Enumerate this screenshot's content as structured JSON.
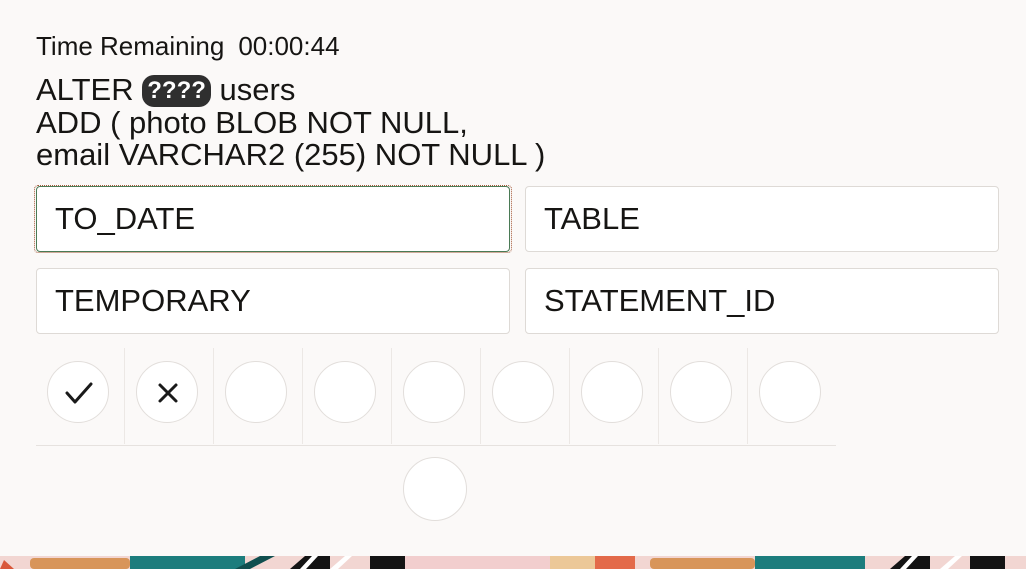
{
  "timer": {
    "label": "Time Remaining",
    "value": "00:00:44"
  },
  "question": {
    "line1_pre": "ALTER",
    "blank": "????",
    "line1_post": "users",
    "line2": "ADD ( photo BLOB NOT NULL,",
    "line3": "email VARCHAR2 (255) NOT NULL )"
  },
  "options": [
    {
      "label": "TO_DATE",
      "selected": true
    },
    {
      "label": "TABLE",
      "selected": false
    },
    {
      "label": "TEMPORARY",
      "selected": false
    },
    {
      "label": "STATEMENT_ID",
      "selected": false
    }
  ],
  "answers": [
    {
      "icon": "check-icon"
    },
    {
      "icon": "close-icon"
    },
    {
      "icon": ""
    },
    {
      "icon": ""
    },
    {
      "icon": ""
    },
    {
      "icon": ""
    },
    {
      "icon": ""
    },
    {
      "icon": ""
    },
    {
      "icon": ""
    }
  ]
}
